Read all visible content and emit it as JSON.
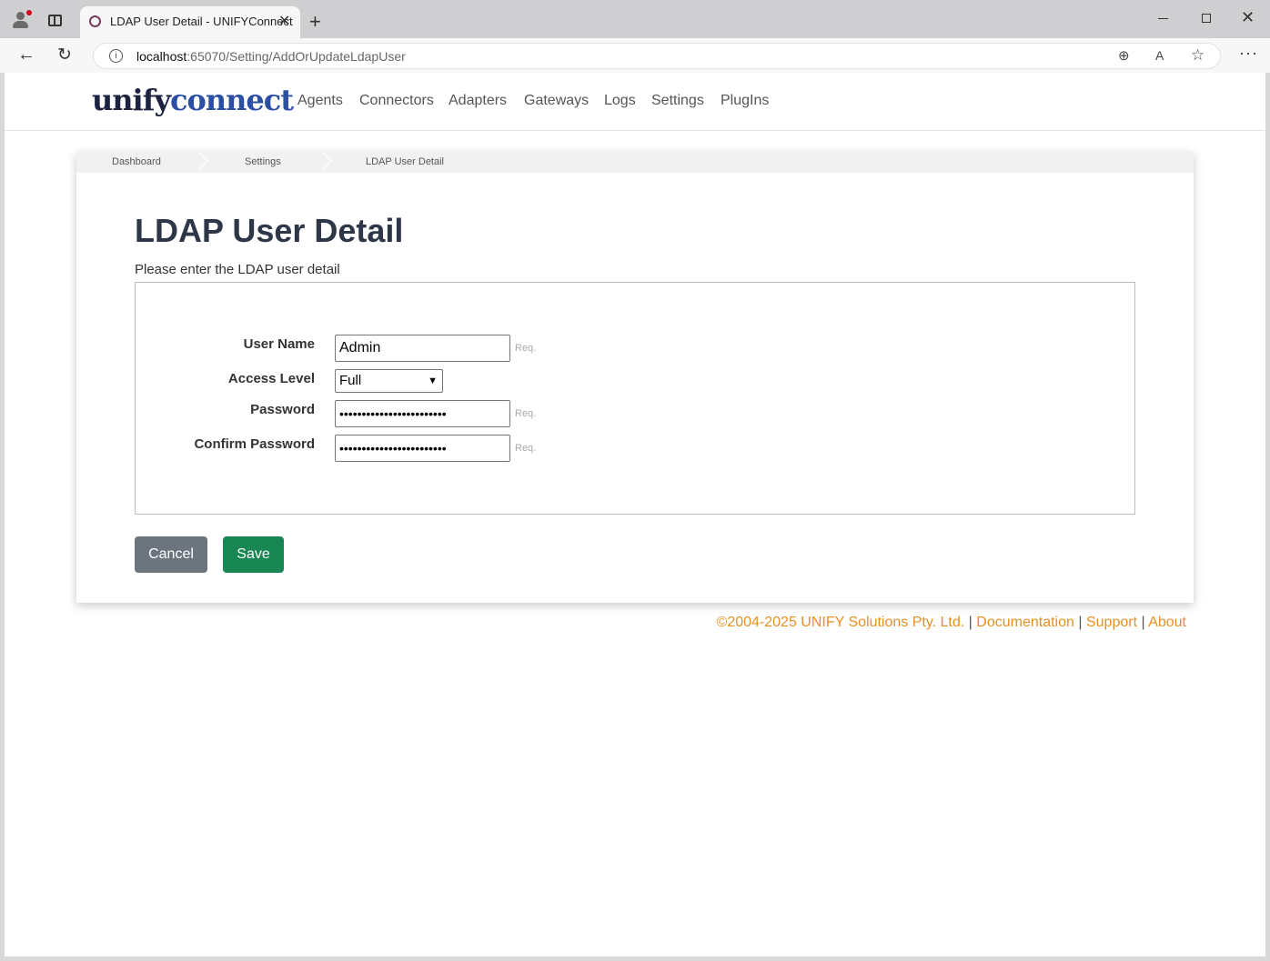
{
  "browser": {
    "tab_title": "LDAP User Detail - UNIFYConnect",
    "url_host": "localhost",
    "url_path": ":65070/Setting/AddOrUpdateLdapUser",
    "new_tab_glyph": "+",
    "close_glyph": "✕"
  },
  "brand": {
    "logo_part1": "unify",
    "logo_part2": "connect"
  },
  "nav": {
    "items": [
      "Agents",
      "Connectors",
      "Adapters",
      "Gateways",
      "Logs",
      "Settings",
      "PlugIns"
    ]
  },
  "breadcrumb": {
    "items": [
      "Dashboard",
      "Settings",
      "LDAP User Detail"
    ]
  },
  "page": {
    "title": "LDAP User Detail",
    "subtitle": "Please enter the LDAP user detail"
  },
  "form": {
    "user_name_label": "User Name",
    "user_name_value": "Admin",
    "access_level_label": "Access Level",
    "access_level_value": "Full",
    "password_label": "Password",
    "password_value": "••••••••••••••••••••••••",
    "confirm_password_label": "Confirm Password",
    "confirm_password_value": "••••••••••••••••••••••••",
    "required_marker": "Req."
  },
  "actions": {
    "cancel_label": "Cancel",
    "save_label": "Save"
  },
  "footer": {
    "copyright": "©2004-2025 UNIFY Solutions Pty. Ltd.",
    "separator": "|",
    "documentation": "Documentation",
    "support": "Support",
    "about": "About"
  },
  "colors": {
    "accent_orange": "#e8901f",
    "save_green": "#198754",
    "cancel_gray": "#6c757d",
    "logo_dark": "#1c2240",
    "logo_blue": "#2b4fa3"
  }
}
